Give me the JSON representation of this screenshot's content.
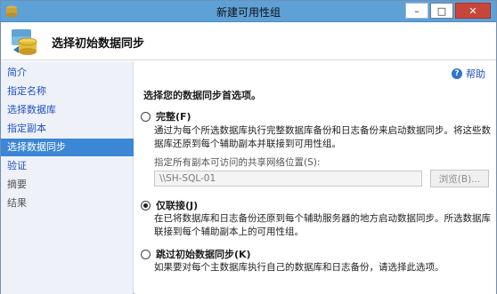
{
  "window": {
    "title": "新建可用性组",
    "minimize_glyph": "–",
    "maximize_glyph": "□",
    "close_glyph": "✕"
  },
  "header": {
    "title": "选择初始数据同步"
  },
  "nav": {
    "items": [
      {
        "label": "简介",
        "state": "link"
      },
      {
        "label": "指定名称",
        "state": "link"
      },
      {
        "label": "选择数据库",
        "state": "link"
      },
      {
        "label": "指定副本",
        "state": "link"
      },
      {
        "label": "选择数据同步",
        "state": "selected"
      },
      {
        "label": "验证",
        "state": "link"
      },
      {
        "label": "摘要",
        "state": "disabled"
      },
      {
        "label": "结果",
        "state": "disabled"
      }
    ]
  },
  "main": {
    "help_label": "帮助",
    "help_icon": "?",
    "instruction": "选择您的数据同步首选项。",
    "options": [
      {
        "label": "完整(F)",
        "checked": false,
        "description": "通过为每个所选数据库执行完整数据库备份和日志备份来启动数据同步。将这些数据库还原到每个辅助副本并联接到可用性组。"
      },
      {
        "label": "仅联接(J)",
        "checked": true,
        "description": "在已将数据库和日志备份还原到每个辅助服务器的地方启动数据同步。所选数据库联接到每个辅助副本上的可用性组。"
      },
      {
        "label": "跳过初始数据同步(K)",
        "checked": false,
        "description": "如果要对每个主数据库执行自己的数据库和日志备份，请选择此选项。"
      }
    ],
    "share_label": "指定所有副本可访问的共享网络位置(S):",
    "share_value": "\\\\SH-SQL-01",
    "browse_label": "浏览(B)..."
  }
}
